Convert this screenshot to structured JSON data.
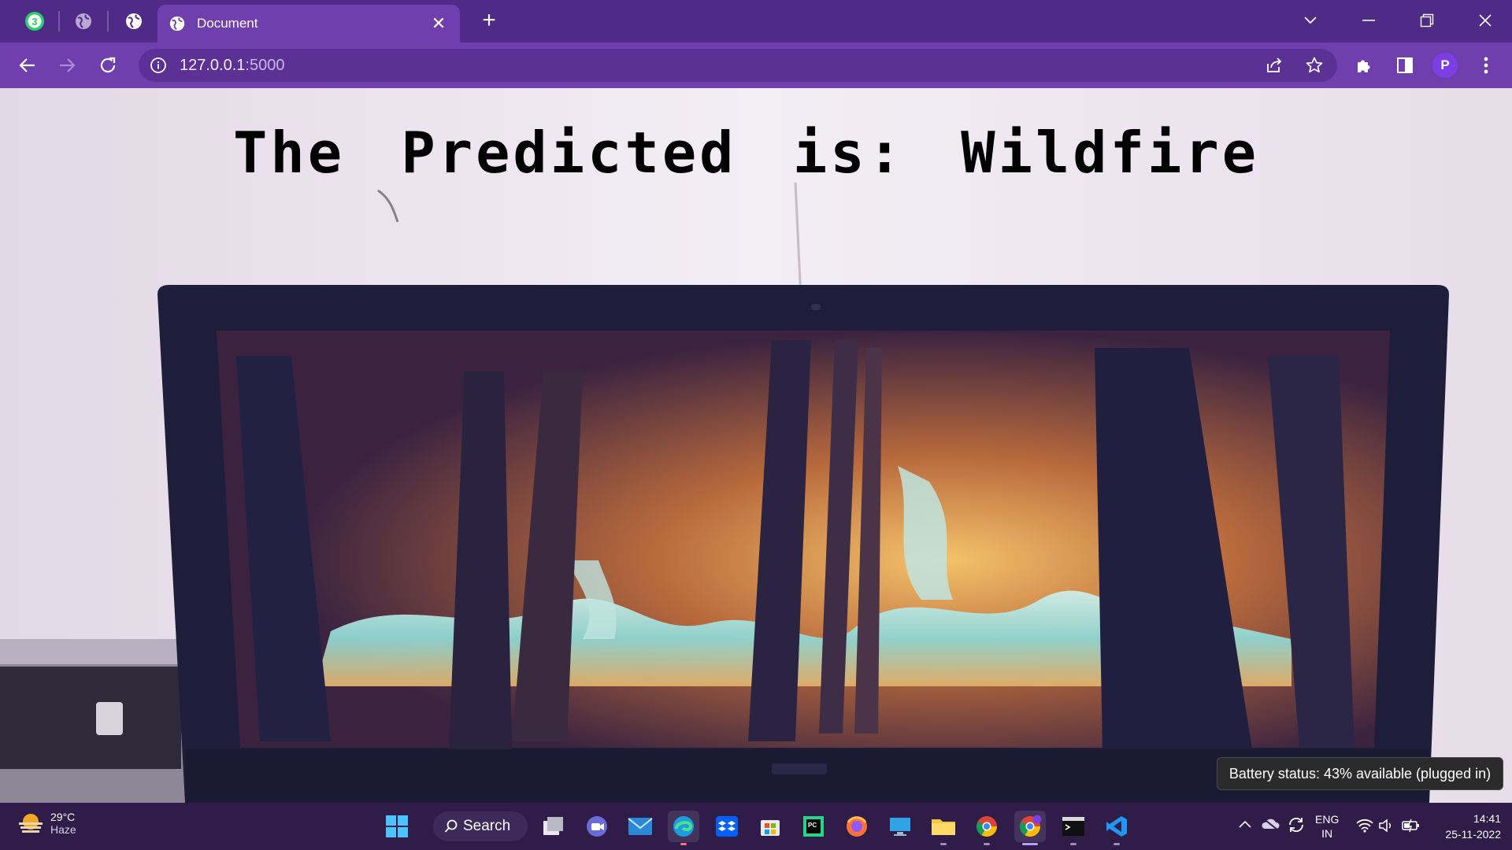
{
  "browser": {
    "tab": {
      "title": "Document",
      "close": "✕"
    },
    "new_tab": "+",
    "address": {
      "host": "127.0.0.1",
      "port": ":5000"
    },
    "profile_initial": "P",
    "whatsapp_badge": "3"
  },
  "page": {
    "prediction_text": "The Predicted is: Wildfire"
  },
  "tooltip": {
    "text": "Battery status: 43% available (plugged in)"
  },
  "taskbar": {
    "weather": {
      "temperature": "29°C",
      "condition": "Haze"
    },
    "search_label": "Search",
    "language": {
      "code": "ENG",
      "region": "IN"
    },
    "clock": {
      "time": "14:41",
      "date": "25-11-2022"
    },
    "apps": [
      "windows-start",
      "search",
      "task-view",
      "teams-chat",
      "mail",
      "edge",
      "dropbox",
      "microsoft-store",
      "pycharm",
      "firefox",
      "remote-desktop",
      "file-explorer",
      "chrome",
      "chrome-profile",
      "terminal",
      "vscode"
    ]
  },
  "colors": {
    "tabstrip": "#4f2a87",
    "toolbar": "#6f3fae",
    "omnibox": "#5c3196",
    "taskbar": "#2f1c48",
    "accent": "#7b3fe4"
  }
}
